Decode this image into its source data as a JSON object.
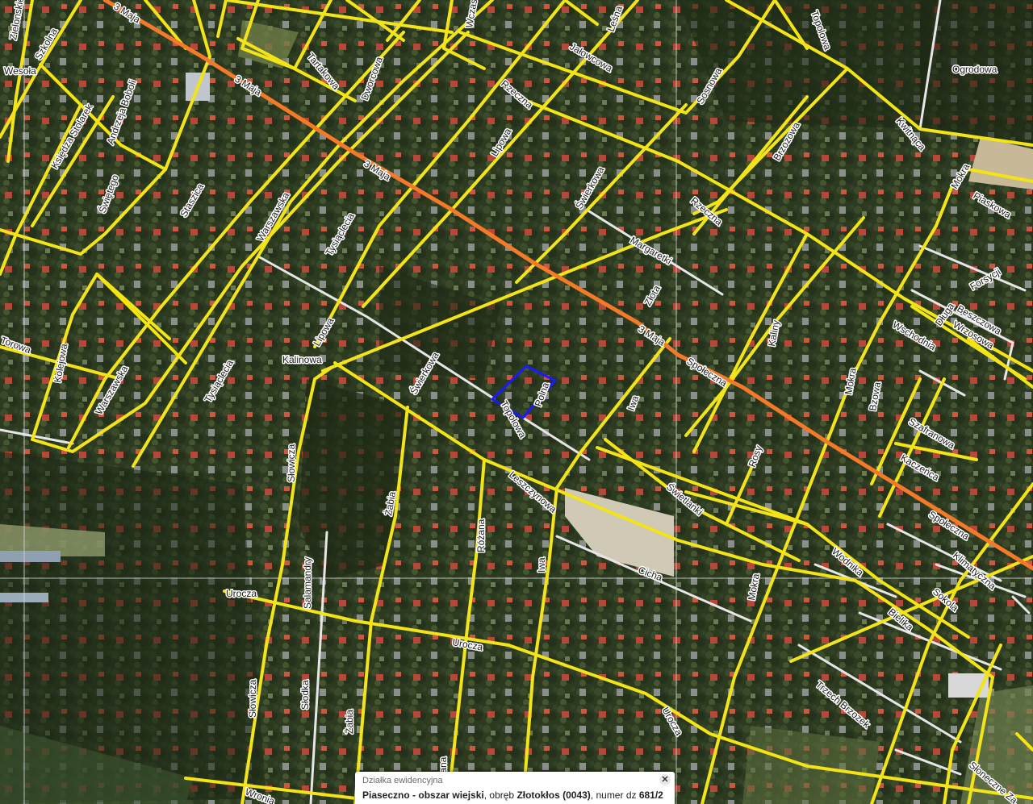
{
  "map": {
    "colors": {
      "road_minor": "#f2e416",
      "road_main": "#f47a2a",
      "road_path": "#e6e6e6",
      "parcel_outline": "#1a1aff",
      "grid_line": "#d9d9d9"
    },
    "road_labels": [
      {
        "id": "3-maja-1",
        "text": "3 Maja"
      },
      {
        "id": "3-maja-2",
        "text": "3 Maja"
      },
      {
        "id": "3-maja-3",
        "text": "3 Maja"
      },
      {
        "id": "3-maja-4",
        "text": "3 Maja"
      },
      {
        "id": "spoleczna-1",
        "text": "Społeczna"
      },
      {
        "id": "spoleczna-2",
        "text": "Społeczna"
      },
      {
        "id": "zielonskie",
        "text": "Zielonskie"
      },
      {
        "id": "wesola",
        "text": "Wesoła"
      },
      {
        "id": "szkolna",
        "text": "Szkolna"
      },
      {
        "id": "ks-stolarek",
        "text": "Księdza Stolarek"
      },
      {
        "id": "bobola",
        "text": "Andrzeja Boboli"
      },
      {
        "id": "swietego",
        "text": "Świętego"
      },
      {
        "id": "staszica",
        "text": "Staszica"
      },
      {
        "id": "warszawska-1",
        "text": "Warszawska"
      },
      {
        "id": "warszawska-2",
        "text": "Warszawska"
      },
      {
        "id": "tysiaclecia-1",
        "text": "Tysiąclecia"
      },
      {
        "id": "tysiaclecia-2",
        "text": "Tysiąclecia"
      },
      {
        "id": "kolejowa",
        "text": "Kolejowa"
      },
      {
        "id": "torowa",
        "text": "Torowa"
      },
      {
        "id": "lipowa-1",
        "text": "Lipowa"
      },
      {
        "id": "lipowa-2",
        "text": "Lipowa"
      },
      {
        "id": "tartakowa",
        "text": "Tartakowa"
      },
      {
        "id": "dworcowa",
        "text": "Dworcowa"
      },
      {
        "id": "wczasowa",
        "text": "Wczasowa"
      },
      {
        "id": "jalowcowa",
        "text": "Jałowcowa"
      },
      {
        "id": "lesna",
        "text": "Leśna"
      },
      {
        "id": "rzeczna-1",
        "text": "Rzeczna"
      },
      {
        "id": "rzeczna-2",
        "text": "Rzeczna"
      },
      {
        "id": "sosnowa",
        "text": "Sosnowa"
      },
      {
        "id": "brzozowa",
        "text": "Brzozowa"
      },
      {
        "id": "topolowa-n",
        "text": "Topolowa"
      },
      {
        "id": "kwiatowa",
        "text": "Kwitnąca"
      },
      {
        "id": "piaskowa",
        "text": "Piaskowa"
      },
      {
        "id": "mokra-1",
        "text": "Mokra"
      },
      {
        "id": "mokra-2",
        "text": "Mokra"
      },
      {
        "id": "mokra-3",
        "text": "Mokra"
      },
      {
        "id": "swierkowa-1",
        "text": "Świerkowa"
      },
      {
        "id": "swierkowa-2",
        "text": "Świerkowa"
      },
      {
        "id": "malgorzatki",
        "text": "Margaretki"
      },
      {
        "id": "zlota",
        "text": "Złota"
      },
      {
        "id": "polna",
        "text": "Polna"
      },
      {
        "id": "dlugi",
        "text": "Długa"
      },
      {
        "id": "topolowa-s",
        "text": "Topolowa"
      },
      {
        "id": "iwa-1",
        "text": "Iwa"
      },
      {
        "id": "iwa-2",
        "text": "Iwa"
      },
      {
        "id": "kalimy",
        "text": "Kaliny"
      },
      {
        "id": "wschodnia",
        "text": "Wschodnia"
      },
      {
        "id": "forsycji",
        "text": "Forsycji"
      },
      {
        "id": "bzowa",
        "text": "Bzowa"
      },
      {
        "id": "wrzosowa",
        "text": "Wrzosowa"
      },
      {
        "id": "szafranowa",
        "text": "Szafranowa"
      },
      {
        "id": "kaczenca",
        "text": "Kaczeńca"
      },
      {
        "id": "rosy",
        "text": "Rosy"
      },
      {
        "id": "swietlanki",
        "text": "Świetlanki"
      },
      {
        "id": "leszczynowa",
        "text": "Leszczynowa"
      },
      {
        "id": "slowicza-1",
        "text": "Słowicza"
      },
      {
        "id": "slowicza-2",
        "text": "Słowicza"
      },
      {
        "id": "zabia-1",
        "text": "Żabia"
      },
      {
        "id": "zabia-2",
        "text": "Żabia"
      },
      {
        "id": "rozana-1",
        "text": "Różana"
      },
      {
        "id": "rozana-2",
        "text": "Różana"
      },
      {
        "id": "salamandry",
        "text": "Salamandry"
      },
      {
        "id": "urocza-1",
        "text": "Urocza"
      },
      {
        "id": "urocza-2",
        "text": "Urocza"
      },
      {
        "id": "urocza-3",
        "text": "Urocza"
      },
      {
        "id": "cicha",
        "text": "Cicha"
      },
      {
        "id": "slodka",
        "text": "Słodka"
      },
      {
        "id": "wronia",
        "text": "Wronia"
      },
      {
        "id": "wodnika",
        "text": "Wodnika"
      },
      {
        "id": "klimatyczna",
        "text": "Klimatyczna"
      },
      {
        "id": "sokola",
        "text": "Sokola"
      },
      {
        "id": "bielika",
        "text": "Bielika"
      },
      {
        "id": "trzech-brzozek",
        "text": "Trzech Brzozek"
      },
      {
        "id": "sloneczne-zacisze",
        "text": "Słoneczne Za..."
      },
      {
        "id": "kalinowa",
        "text": "Kalinowa"
      },
      {
        "id": "beskidzka",
        "text": "Beszczowa"
      },
      {
        "id": "ogrodowa",
        "text": "Ogrodowa"
      }
    ]
  },
  "popup": {
    "title": "Działka ewidencyjna",
    "region": "Piaseczno - obszar wiejski",
    "precinct_prefix": ", obręb ",
    "precinct": "Złotokłos (0043)",
    "number_prefix": ", numer dz ",
    "number": "681/2",
    "close_label": "✕"
  }
}
